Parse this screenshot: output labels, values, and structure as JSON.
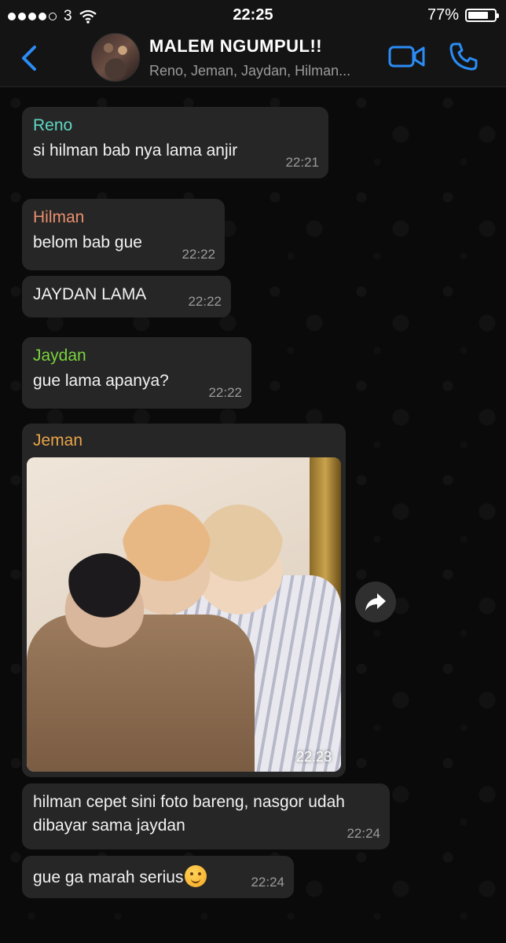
{
  "status_bar": {
    "carrier": "3",
    "time": "22:25",
    "battery": "77%",
    "battery_level": 0.77
  },
  "header": {
    "title": "MALEM NGUMPUL!!",
    "subtitle": "Reno, Jeman, Jaydan, Hilman..."
  },
  "colors": {
    "accent": "#2b8cf6",
    "bubble": "#262626",
    "reno": "#5fd8c4",
    "hilman": "#e9906e",
    "jaydan": "#7ad33f",
    "jeman": "#e8a44a"
  },
  "icons": {
    "back": "chevron-left-icon",
    "video": "video-camera-icon",
    "call": "phone-icon",
    "share": "forward-arrow-icon"
  },
  "messages": [
    {
      "sender": "Reno",
      "text": "si hilman bab nya lama anjir",
      "time": "22:21"
    },
    {
      "sender": "Hilman",
      "text": "belom bab gue",
      "time": "22:22"
    },
    {
      "sender": "",
      "text": "JAYDAN LAMA",
      "time": "22:22"
    },
    {
      "sender": "Jaydan",
      "text": "gue lama apanya?",
      "time": "22:22"
    },
    {
      "sender": "Jeman",
      "text": "",
      "time": "22:23",
      "type": "photo"
    },
    {
      "sender": "",
      "text_line1": "hilman cepet sini foto bareng, nasgor udah",
      "text_line2": "dibayar sama jaydan",
      "time": "22:24"
    },
    {
      "sender": "",
      "text": "gue ga marah serius",
      "emoji": "hugging-face-emoji",
      "time": "22:24"
    }
  ]
}
